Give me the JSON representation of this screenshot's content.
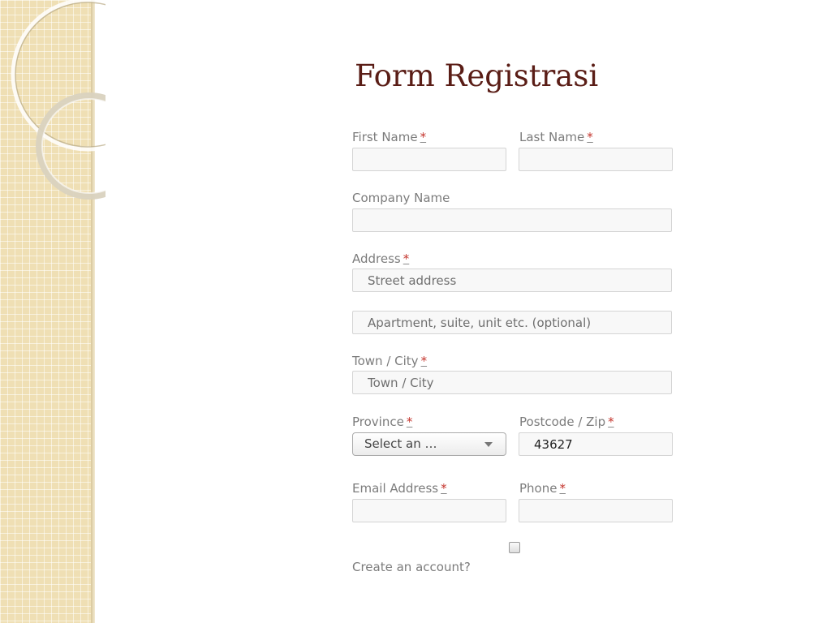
{
  "slide": {
    "title": "Form Registrasi"
  },
  "form": {
    "first_name": {
      "label": "First Name",
      "required_mark": "*",
      "value": ""
    },
    "last_name": {
      "label": "Last Name",
      "required_mark": "*",
      "value": ""
    },
    "company_name": {
      "label": "Company Name",
      "value": ""
    },
    "address": {
      "label": "Address",
      "required_mark": "*",
      "line1_placeholder": "Street address",
      "line2_placeholder": "Apartment, suite, unit etc. (optional)"
    },
    "town_city": {
      "label": "Town / City",
      "required_mark": "*",
      "placeholder": "Town / City"
    },
    "province": {
      "label": "Province",
      "required_mark": "*",
      "selected": "Select an …"
    },
    "postcode": {
      "label": "Postcode / Zip",
      "required_mark": "*",
      "value": "43627"
    },
    "email": {
      "label": "Email Address",
      "required_mark": "*",
      "value": ""
    },
    "phone": {
      "label": "Phone",
      "required_mark": "*",
      "value": ""
    },
    "create_account": {
      "label": "Create an account?",
      "checked": false
    }
  },
  "colors": {
    "title": "#5a1d16",
    "required": "#c4342c",
    "sidebar": "#efdfb4"
  }
}
